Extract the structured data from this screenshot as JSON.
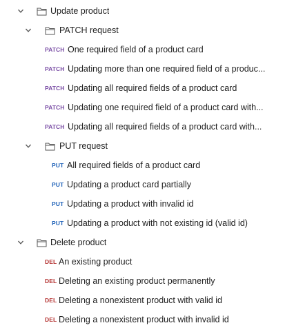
{
  "folders": {
    "update_product": "Update product",
    "patch_request": "PATCH request",
    "put_request": "PUT request",
    "delete_product": "Delete product"
  },
  "methods": {
    "patch": "PATCH",
    "put": "PUT",
    "del": "DEL"
  },
  "patch_items": [
    "One required field of a product card",
    "Updating more than one required field of a produc...",
    "Updating all required fields of a product card",
    "Updating one required field of a product card with...",
    "Updating all required fields of a product card with..."
  ],
  "put_items": [
    "All required fields of a product card",
    "Updating a product card partially",
    "Updating a product with invalid id",
    "Updating a product with not existing id (valid id)"
  ],
  "delete_items": [
    "An existing product",
    "Deleting an existing product permanently",
    "Deleting a nonexistent product with valid id",
    "Deleting a nonexistent product with invalid id"
  ],
  "colors": {
    "patch": "#7b4fa6",
    "put": "#1f62b8",
    "del": "#b3302f"
  },
  "icons": {
    "expand": "chevron-down-icon",
    "folder": "folder-icon"
  }
}
